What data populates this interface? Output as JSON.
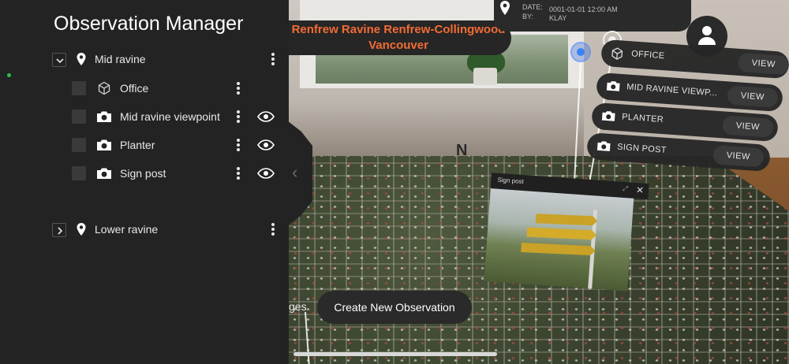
{
  "panel": {
    "title": "Observation Manager",
    "groups": [
      {
        "name": "Mid ravine",
        "expanded": true,
        "items": [
          {
            "label": "Office",
            "icon": "cube-icon",
            "visible_toggle": false
          },
          {
            "label": "Mid ravine viewpoint",
            "icon": "camera-icon",
            "visible_toggle": true
          },
          {
            "label": "Planter",
            "icon": "camera-icon",
            "visible_toggle": true
          },
          {
            "label": "Sign post",
            "icon": "camera-icon",
            "visible_toggle": true
          }
        ]
      },
      {
        "name": "Lower ravine",
        "expanded": false,
        "items": []
      }
    ]
  },
  "location": {
    "line1": "Renfrew Ravine Renfrew-Collingwood",
    "line2": "Vancouver"
  },
  "info": {
    "date_label": "DATE:",
    "date_value": "0001-01-01 12:00 AM",
    "by_label": "BY:",
    "by_value": "KLAY"
  },
  "observations": [
    {
      "name": "OFFICE",
      "view": "VIEW",
      "icon": "cube-icon"
    },
    {
      "name": "MID RAVINE VIEWP...",
      "view": "VIEW",
      "icon": "camera-icon"
    },
    {
      "name": "PLANTER",
      "view": "VIEW",
      "icon": "camera-icon"
    },
    {
      "name": "SIGN POST",
      "view": "VIEW",
      "icon": "camera-icon"
    }
  ],
  "preview": {
    "title": "Sign post",
    "close": "✕"
  },
  "map": {
    "north": "N"
  },
  "actions": {
    "create": "Create New Observation",
    "partial_label": "ges"
  },
  "colors": {
    "accent": "#f26b35",
    "panel": "#232323",
    "status": "#27c24c",
    "marker": "#3b82f6"
  }
}
